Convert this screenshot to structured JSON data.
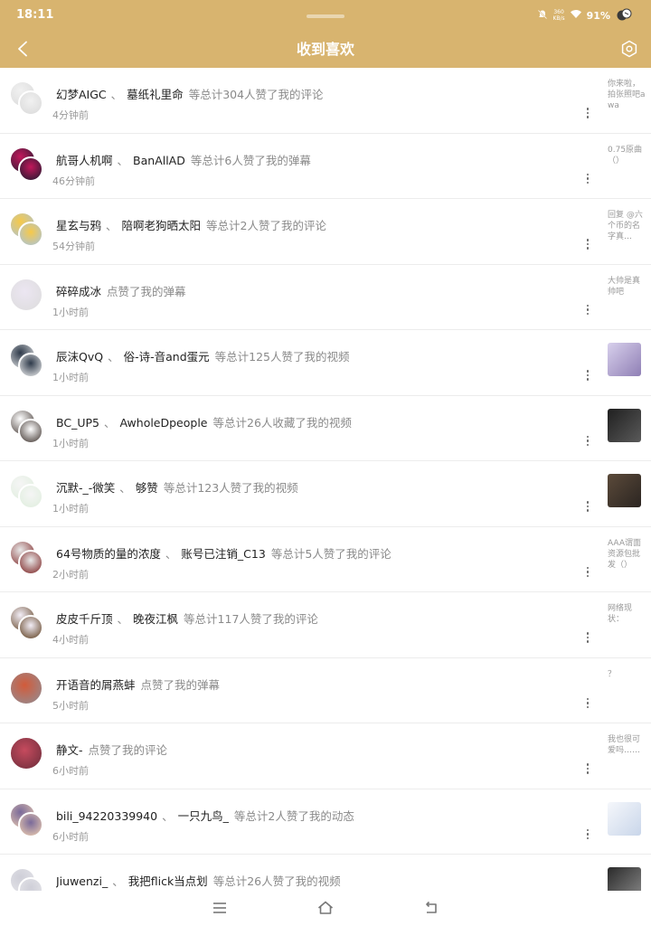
{
  "status_bar": {
    "time": "18:11",
    "speed_value": "360",
    "speed_unit": "KB/s",
    "battery": "91%",
    "icons": [
      "mute-icon",
      "wifi-icon",
      "battery-icon"
    ]
  },
  "header": {
    "title": "收到喜欢",
    "back_icon": "chevron-left-icon",
    "settings_icon": "settings-hexagon-icon",
    "background": "#d8b46f"
  },
  "notifications": [
    {
      "users": [
        "幻梦AIGC",
        "墓纸礼里命"
      ],
      "action": "等总计304人赞了我的评论",
      "time": "4分钟前",
      "preview_text": "你来啦，拍张照吧awa",
      "has_image": false
    },
    {
      "users": [
        "航哥人机啊",
        "BanAllAD"
      ],
      "action": "等总计6人赞了我的弹幕",
      "time": "46分钟前",
      "preview_text": "0.75原曲（）",
      "has_image": false
    },
    {
      "users": [
        "星玄与鸦",
        "陪啊老狗晒太阳"
      ],
      "action": "等总计2人赞了我的评论",
      "time": "54分钟前",
      "preview_text": "回复 @六个币的名字真…",
      "has_image": false
    },
    {
      "users": [
        "碎碎成冰"
      ],
      "action": "点赞了我的弹幕",
      "time": "1小时前",
      "preview_text": "大帅是真帅吧",
      "has_image": false
    },
    {
      "users": [
        "辰沫QvQ",
        "俗-诗-音and蛋元"
      ],
      "action": "等总计125人赞了我的视频",
      "time": "1小时前",
      "preview_text": "",
      "has_image": true
    },
    {
      "users": [
        "BC_UP5",
        "AwholeDpeople"
      ],
      "action": "等总计26人收藏了我的视频",
      "time": "1小时前",
      "preview_text": "",
      "has_image": true
    },
    {
      "users": [
        "沉默-_-微笑",
        "够赞"
      ],
      "action": "等总计123人赞了我的视频",
      "time": "1小时前",
      "preview_text": "",
      "has_image": true
    },
    {
      "users": [
        "64号物质的量的浓度",
        "账号已注销_C13"
      ],
      "action": "等总计5人赞了我的评论",
      "time": "2小时前",
      "preview_text": "AAA谓面资源包批发（）",
      "has_image": false
    },
    {
      "users": [
        "皮皮千斤顶",
        "晚夜江枫"
      ],
      "action": "等总计117人赞了我的评论",
      "time": "4小时前",
      "preview_text": "网络现状：",
      "has_image": false
    },
    {
      "users": [
        "开语音的屑燕蚌"
      ],
      "action": "点赞了我的弹幕",
      "time": "5小时前",
      "preview_text": "？",
      "has_image": false
    },
    {
      "users": [
        "静文-"
      ],
      "action": "点赞了我的评论",
      "time": "6小时前",
      "preview_text": "我也很可爱吗……",
      "has_image": false
    },
    {
      "users": [
        "bili_94220339940",
        "一只九鸟_"
      ],
      "action": "等总计2人赞了我的动态",
      "time": "6小时前",
      "preview_text": "",
      "has_image": true
    },
    {
      "users": [
        "Jiuwenzi_",
        "我把flick当点划"
      ],
      "action": "等总计26人赞了我的视频",
      "time": "",
      "preview_text": "",
      "has_image": true
    }
  ],
  "separator": "、",
  "more_icon": "more-vertical-icon",
  "nav_bar": {
    "icons": [
      "menu-icon",
      "home-icon",
      "back-icon"
    ]
  }
}
